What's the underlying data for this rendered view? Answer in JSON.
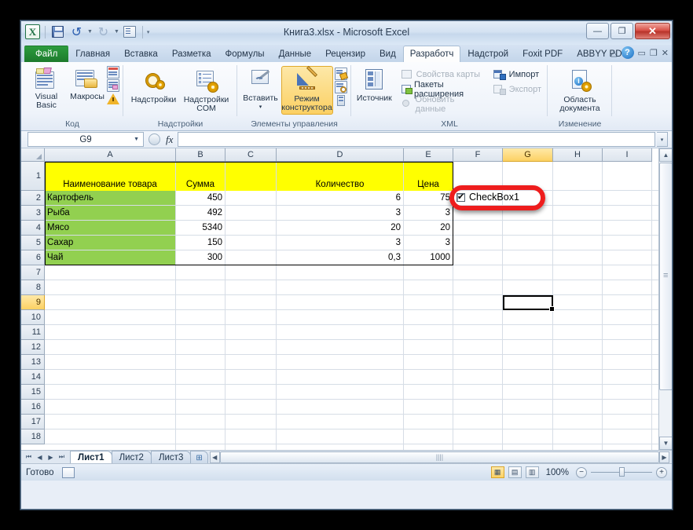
{
  "window": {
    "title": "Книга3.xlsx  -  Microsoft Excel",
    "minimize": "—",
    "restore": "❐",
    "close": "✕"
  },
  "quick_access": {
    "logo": "X",
    "save": "save-icon",
    "undo": "↰",
    "redo": "↱",
    "customize": "▾"
  },
  "tabs": [
    {
      "label": "Файл",
      "active": false,
      "kind": "file"
    },
    {
      "label": "Главная",
      "active": false
    },
    {
      "label": "Вставка",
      "active": false
    },
    {
      "label": "Разметка",
      "active": false
    },
    {
      "label": "Формулы",
      "active": false
    },
    {
      "label": "Данные",
      "active": false
    },
    {
      "label": "Рецензир",
      "active": false
    },
    {
      "label": "Вид",
      "active": false
    },
    {
      "label": "Разработч",
      "active": true
    },
    {
      "label": "Надстрой",
      "active": false
    },
    {
      "label": "Foxit PDF",
      "active": false
    },
    {
      "label": "ABBYY PDF",
      "active": false
    }
  ],
  "tab_icons": {
    "ribbon_toggle": "△",
    "help": "?",
    "minimize": "▭",
    "restore": "❐",
    "close": "✕"
  },
  "ribbon": {
    "groups": [
      {
        "label": "Код",
        "buttons": [
          {
            "label": "Visual Basic",
            "icon": "visual-basic-icon"
          },
          {
            "label": "Макросы",
            "icon": "macros-icon"
          }
        ],
        "small": [
          {
            "label": "",
            "icon": "record-macro-icon"
          },
          {
            "label": "",
            "icon": "relative-refs-icon"
          },
          {
            "label": "",
            "icon": "macro-security-icon"
          }
        ]
      },
      {
        "label": "Надстройки",
        "buttons": [
          {
            "label": "Надстройки",
            "icon": "addins-icon"
          },
          {
            "label": "Надстройки COM",
            "icon": "com-addins-icon"
          }
        ]
      },
      {
        "label": "Элементы управления",
        "buttons": [
          {
            "label": "Вставить",
            "icon": "insert-control-icon",
            "dropdown": "▾"
          },
          {
            "label": "Режим конструктора",
            "icon": "design-mode-icon",
            "selected": true
          }
        ],
        "small": [
          {
            "label": "",
            "icon": "properties-icon"
          },
          {
            "label": "",
            "icon": "view-code-icon"
          },
          {
            "label": "",
            "icon": "run-dialog-icon"
          }
        ]
      },
      {
        "label": "XML",
        "buttons": [
          {
            "label": "Источник",
            "icon": "xml-source-icon"
          }
        ],
        "small": [
          {
            "label": "Свойства карты",
            "icon": "map-properties-icon",
            "disabled": true
          },
          {
            "label": "Пакеты расширения",
            "icon": "expansion-packs-icon",
            "disabled": false
          },
          {
            "label": "Обновить данные",
            "icon": "refresh-data-icon",
            "disabled": true
          },
          {
            "label": "Импорт",
            "icon": "import-icon",
            "disabled": false
          },
          {
            "label": "Экспорт",
            "icon": "export-icon",
            "disabled": true
          }
        ]
      },
      {
        "label": "Изменение",
        "buttons": [
          {
            "label": "Область документа",
            "icon": "document-panel-icon"
          }
        ]
      }
    ]
  },
  "formula_bar": {
    "name_box": "G9",
    "name_box_dropdown": "▼",
    "fx_label": "fx",
    "formula_value": "",
    "expand_dropdown": "▾"
  },
  "grid": {
    "columns": [
      "A",
      "B",
      "C",
      "D",
      "E",
      "F",
      "G",
      "H",
      "I"
    ],
    "selected_column": "G",
    "rows": [
      "1",
      "2",
      "3",
      "4",
      "5",
      "6",
      "7",
      "8",
      "9",
      "10",
      "11",
      "12",
      "13",
      "14",
      "15",
      "16",
      "17",
      "18"
    ],
    "selected_row": "9",
    "active_cell": "G9",
    "headers": {
      "A": "Наименование товара",
      "B": "Сумма",
      "C": "",
      "D": "Количество",
      "E": "Цена"
    },
    "data": [
      {
        "row": "2",
        "A": "Картофель",
        "B": "450",
        "C": "",
        "D": "6",
        "E": "75"
      },
      {
        "row": "3",
        "A": "Рыба",
        "B": "492",
        "C": "",
        "D": "3",
        "E": "3"
      },
      {
        "row": "4",
        "A": "Мясо",
        "B": "5340",
        "C": "",
        "D": "20",
        "E": "20"
      },
      {
        "row": "5",
        "A": "Сахар",
        "B": "150",
        "C": "",
        "D": "3",
        "E": "3"
      },
      {
        "row": "6",
        "A": "Чай",
        "B": "300",
        "C": "",
        "D": "0,3",
        "E": "1000"
      }
    ],
    "colors": {
      "header_fill": "#FFFF00",
      "data_fill": "#92D050",
      "annotation": "#EE1D1D"
    }
  },
  "control": {
    "checkbox_label": "CheckBox1",
    "checked": true,
    "check_glyph": "✔"
  },
  "sheet_tabs": {
    "nav": [
      "⏮",
      "◀",
      "▶",
      "⏭"
    ],
    "items": [
      {
        "label": "Лист1",
        "active": true
      },
      {
        "label": "Лист2",
        "active": false
      },
      {
        "label": "Лист3",
        "active": false
      }
    ],
    "new_sheet_icon": "new-sheet-icon"
  },
  "status_bar": {
    "state": "Готово",
    "macro_record_icon": "record-macro-icon",
    "views": [
      {
        "name": "normal-view",
        "glyph": "▦",
        "active": true
      },
      {
        "name": "page-layout-view",
        "glyph": "▤",
        "active": false
      },
      {
        "name": "page-break-view",
        "glyph": "▥",
        "active": false
      }
    ],
    "zoom": "100%",
    "zoom_out": "−",
    "zoom_in": "+"
  }
}
